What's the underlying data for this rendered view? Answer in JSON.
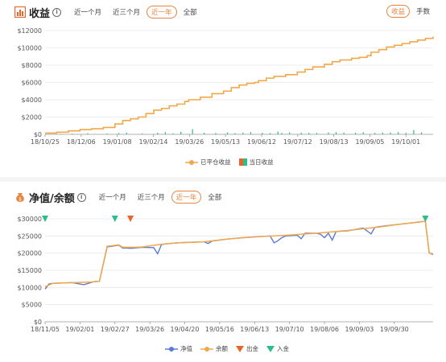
{
  "colors": {
    "orange": "#f0a84a",
    "green": "#2bbd8c",
    "blue": "#5b7bd5",
    "red": "#e8652a",
    "accent": "#e8843f",
    "grid": "#e8e8e8"
  },
  "panel1": {
    "title": "收益",
    "info": "i",
    "tabs": [
      "近一个月",
      "近三个月",
      "近一年",
      "全部"
    ],
    "active_tab": "近一年",
    "right_tabs": [
      "收益",
      "手数"
    ],
    "active_right_tab": "收益",
    "legend": [
      "已平仓收益",
      "当日收益"
    ]
  },
  "panel2": {
    "title": "净值/余额",
    "info": "i",
    "tabs": [
      "近一个月",
      "近三个月",
      "近一年",
      "全部"
    ],
    "active_tab": "近一年",
    "legend": [
      "净值",
      "余额",
      "出金",
      "入金"
    ]
  },
  "chart_data": [
    {
      "type": "line",
      "ylim": [
        0,
        12000
      ],
      "yticks": [
        0,
        2000,
        4000,
        6000,
        8000,
        10000,
        12000
      ],
      "ytick_labels": [
        "$0",
        "$2000",
        "$4000",
        "$6000",
        "$8000",
        "$10000",
        "$12000"
      ],
      "xlim": [
        "2018-10-25",
        "2018-12-06",
        "2019-01-08",
        "2019-02-14",
        "2019-03-26",
        "2019-05-13",
        "2019-06-12",
        "2019-07-12",
        "2019-08-13",
        "2019-09-05",
        "2019-10-01"
      ],
      "x_tick_labels": [
        "18/10/25",
        "18/12/06",
        "19/01/08",
        "19/02/14",
        "19/03/26",
        "19/05/13",
        "19/06/12",
        "19/07/12",
        "19/08/13",
        "19/09/05",
        "19/10/01"
      ],
      "grid": true,
      "legend_position": "bottom",
      "series": [
        {
          "name": "已平仓收益",
          "kind": "line",
          "x": [
            0,
            0.03,
            0.06,
            0.09,
            0.12,
            0.15,
            0.18,
            0.2,
            0.22,
            0.24,
            0.26,
            0.28,
            0.3,
            0.32,
            0.34,
            0.36,
            0.37,
            0.4,
            0.43,
            0.46,
            0.48,
            0.5,
            0.52,
            0.54,
            0.55,
            0.57,
            0.59,
            0.62,
            0.65,
            0.67,
            0.69,
            0.72,
            0.74,
            0.76,
            0.79,
            0.81,
            0.83,
            0.84,
            0.86,
            0.88,
            0.9,
            0.92,
            0.94,
            0.96,
            0.98,
            1.0
          ],
          "y": [
            150,
            250,
            400,
            550,
            650,
            800,
            1200,
            1600,
            1800,
            2000,
            2400,
            2800,
            3000,
            3300,
            3500,
            3800,
            4000,
            4300,
            4700,
            5000,
            5400,
            5700,
            5900,
            6000,
            6200,
            6500,
            6700,
            6900,
            7200,
            7500,
            7800,
            8100,
            8400,
            8600,
            8800,
            8900,
            9100,
            9500,
            9800,
            10100,
            10300,
            10500,
            10700,
            10900,
            11100,
            11300
          ]
        },
        {
          "name": "当日收益",
          "kind": "bar",
          "x": [
            0.04,
            0.07,
            0.11,
            0.16,
            0.19,
            0.21,
            0.25,
            0.29,
            0.31,
            0.33,
            0.35,
            0.38,
            0.41,
            0.44,
            0.47,
            0.49,
            0.51,
            0.53,
            0.56,
            0.58,
            0.6,
            0.61,
            0.63,
            0.66,
            0.68,
            0.7,
            0.73,
            0.75,
            0.77,
            0.8,
            0.82,
            0.85,
            0.87,
            0.89,
            0.91,
            0.93,
            0.95,
            0.97
          ],
          "y": [
            60,
            80,
            120,
            90,
            150,
            200,
            100,
            180,
            250,
            120,
            300,
            600,
            180,
            160,
            220,
            140,
            200,
            260,
            180,
            150,
            320,
            160,
            240,
            200,
            180,
            150,
            220,
            260,
            200,
            180,
            240,
            160,
            200,
            220,
            260,
            180,
            500,
            240
          ]
        }
      ]
    },
    {
      "type": "line",
      "ylim": [
        0,
        30000
      ],
      "yticks": [
        0,
        5000,
        10000,
        15000,
        20000,
        25000,
        30000
      ],
      "ytick_labels": [
        "$0",
        "$5000",
        "$10000",
        "$15000",
        "$20000",
        "$25000",
        "$30000"
      ],
      "x_tick_labels": [
        "18/11/05",
        "19/02/01",
        "19/02/27",
        "19/03/26",
        "19/04/20",
        "19/05/16",
        "19/06/13",
        "19/07/10",
        "19/08/06",
        "19/09/03",
        "19/09/30"
      ],
      "grid": true,
      "legend_position": "bottom",
      "series": [
        {
          "name": "净值",
          "kind": "line",
          "x": [
            0.0,
            0.01,
            0.02,
            0.04,
            0.07,
            0.1,
            0.12,
            0.13,
            0.14,
            0.16,
            0.19,
            0.2,
            0.21,
            0.22,
            0.23,
            0.25,
            0.28,
            0.29,
            0.3,
            0.31,
            0.34,
            0.38,
            0.41,
            0.42,
            0.43,
            0.47,
            0.51,
            0.55,
            0.58,
            0.59,
            0.6,
            0.61,
            0.62,
            0.65,
            0.66,
            0.67,
            0.7,
            0.71,
            0.72,
            0.73,
            0.74,
            0.75,
            0.78,
            0.82,
            0.84,
            0.85,
            0.86,
            0.88,
            0.92,
            0.96,
            0.98,
            0.99,
            1.0
          ],
          "y": [
            9500,
            11000,
            11200,
            11300,
            11400,
            10800,
            11500,
            11800,
            11800,
            21800,
            22300,
            21500,
            21500,
            21400,
            21500,
            21700,
            21600,
            19800,
            22500,
            22700,
            23000,
            23200,
            23300,
            22800,
            23500,
            24100,
            24500,
            24800,
            25000,
            23000,
            23600,
            24500,
            25000,
            25200,
            24200,
            25800,
            25800,
            25500,
            24500,
            25800,
            23800,
            26300,
            26500,
            27300,
            25600,
            27500,
            27700,
            28000,
            28500,
            29000,
            29300,
            20000,
            19600
          ]
        },
        {
          "name": "余额",
          "kind": "line",
          "x": [
            0.0,
            0.02,
            0.07,
            0.12,
            0.14,
            0.16,
            0.19,
            0.2,
            0.23,
            0.25,
            0.3,
            0.34,
            0.41,
            0.47,
            0.55,
            0.62,
            0.7,
            0.78,
            0.86,
            0.92,
            0.98,
            0.99,
            1.0
          ],
          "y": [
            10200,
            11200,
            11400,
            11600,
            11800,
            22000,
            22400,
            21700,
            21700,
            21800,
            22600,
            23000,
            23300,
            24100,
            24800,
            25200,
            25800,
            26600,
            27600,
            28500,
            29300,
            20000,
            19800
          ]
        },
        {
          "name": "出金",
          "kind": "marker",
          "x": [
            0.22
          ],
          "y": [
            30000
          ]
        },
        {
          "name": "入金",
          "kind": "marker",
          "x": [
            0.0,
            0.18,
            0.98
          ],
          "y": [
            30000,
            30000,
            30000
          ]
        }
      ]
    }
  ]
}
